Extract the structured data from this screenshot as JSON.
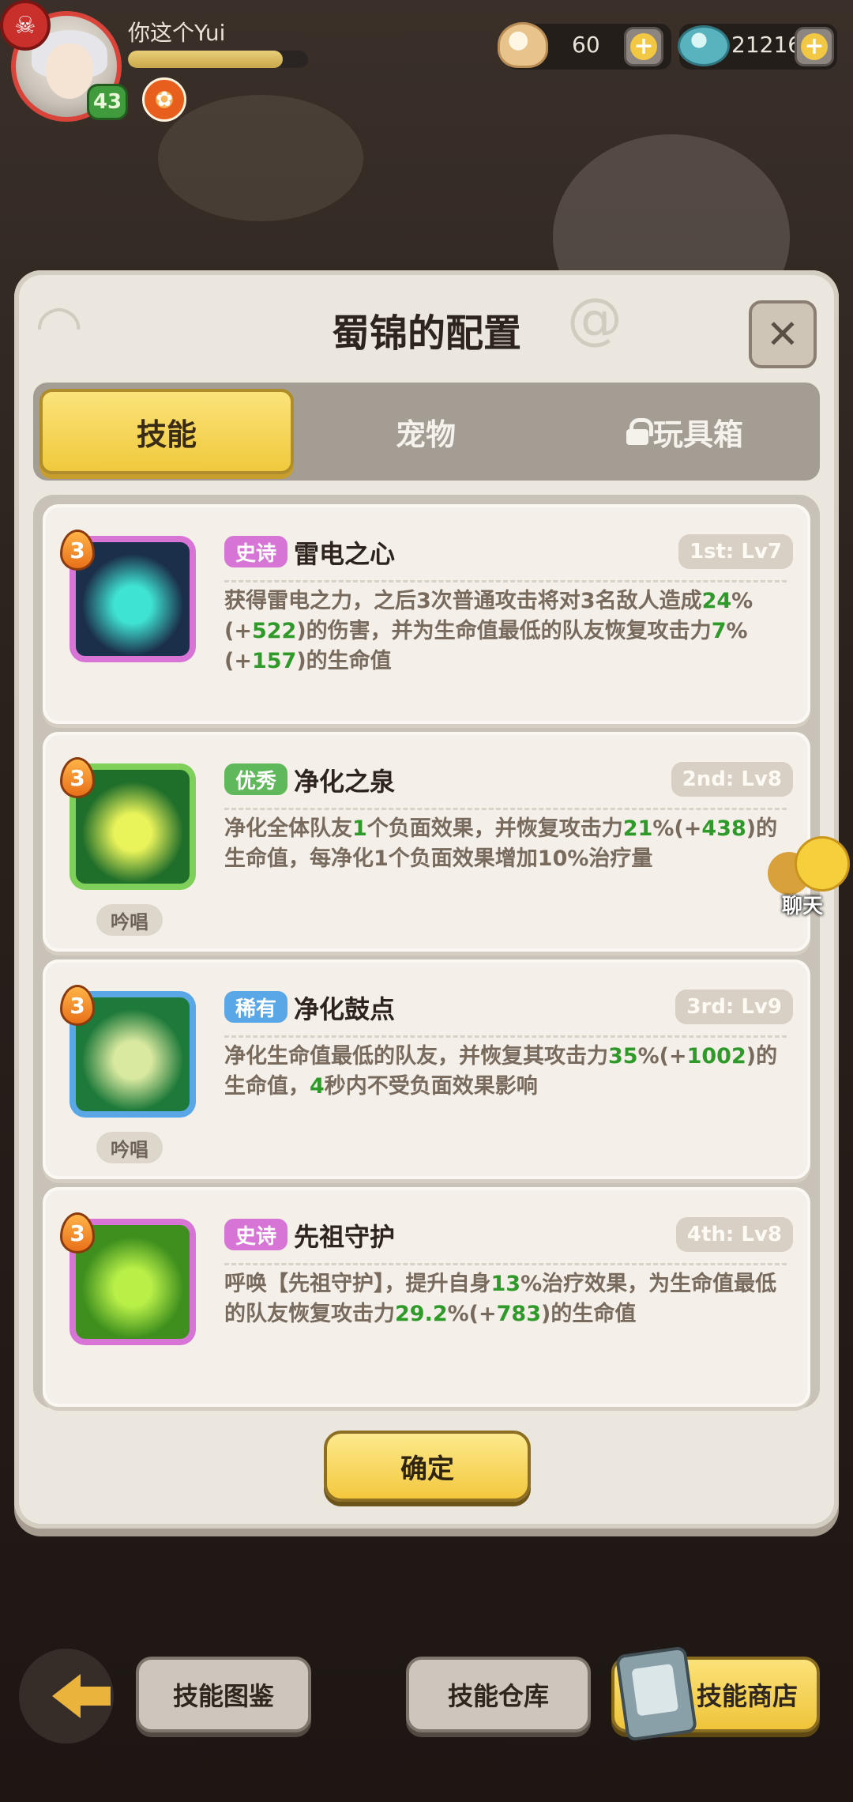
{
  "hud": {
    "player_name": "你这个Yui",
    "level": "43",
    "xp_fraction": 0.86,
    "shells": "60",
    "gems": "21216"
  },
  "dialog": {
    "title": "蜀锦的配置",
    "tabs": [
      {
        "label": "技能",
        "active": true,
        "locked": false
      },
      {
        "label": "宠物",
        "active": false,
        "locked": false
      },
      {
        "label": "玩具箱",
        "active": false,
        "locked": true
      }
    ],
    "skills": [
      {
        "rank": "3",
        "rarity": "史诗",
        "rarity_color": "#d775d6",
        "name": "雷电之心",
        "slot_level": "1st: Lv7",
        "chant": "",
        "desc_parts": [
          {
            "t": "获得雷电之力，之后3次普通攻击将对3名敌人造成"
          },
          {
            "t": "24",
            "g": true
          },
          {
            "t": "%(+"
          },
          {
            "t": "522",
            "g": true
          },
          {
            "t": ")的伤害，并为生命值最低的队友恢复攻击力"
          },
          {
            "t": "7",
            "g": true
          },
          {
            "t": "%(+"
          },
          {
            "t": "157",
            "g": true
          },
          {
            "t": ")的生命值"
          }
        ],
        "icon_colors": [
          "#d774d6",
          "#1b2f4a",
          "#3fe3d3"
        ]
      },
      {
        "rank": "3",
        "rarity": "优秀",
        "rarity_color": "#5fb95a",
        "name": "净化之泉",
        "slot_level": "2nd: Lv8",
        "chant": "吟唱",
        "desc_parts": [
          {
            "t": "净化全体队友"
          },
          {
            "t": "1",
            "g": true
          },
          {
            "t": "个负面效果，并恢复攻击力"
          },
          {
            "t": "21",
            "g": true
          },
          {
            "t": "%(+"
          },
          {
            "t": "438",
            "g": true
          },
          {
            "t": ")的生命值，每净化1个负面效果增加10%治疗量"
          }
        ],
        "icon_colors": [
          "#7fcf5b",
          "#1f6e2a",
          "#e9f35a"
        ]
      },
      {
        "rank": "3",
        "rarity": "稀有",
        "rarity_color": "#5aa7e8",
        "name": "净化鼓点",
        "slot_level": "3rd: Lv9",
        "chant": "吟唱",
        "desc_parts": [
          {
            "t": "净化生命值最低的队友，并恢复其攻击力"
          },
          {
            "t": "35",
            "g": true
          },
          {
            "t": "%(+"
          },
          {
            "t": "1002",
            "g": true
          },
          {
            "t": ")的生命值，"
          },
          {
            "t": "4",
            "g": true
          },
          {
            "t": "秒内不受负面效果影响"
          }
        ],
        "icon_colors": [
          "#5aa7e8",
          "#1e7a3a",
          "#d9e9a0"
        ]
      },
      {
        "rank": "3",
        "rarity": "史诗",
        "rarity_color": "#d775d6",
        "name": "先祖守护",
        "slot_level": "4th: Lv8",
        "chant": "",
        "desc_parts": [
          {
            "t": "呼唤【先祖守护】，提升自身"
          },
          {
            "t": "13",
            "g": true
          },
          {
            "t": "%治疗效果，为生命值最低的队友恢复攻击力"
          },
          {
            "t": "29.2",
            "g": true
          },
          {
            "t": "%(+"
          },
          {
            "t": "783",
            "g": true
          },
          {
            "t": ")的生命值"
          }
        ],
        "icon_colors": [
          "#d774d6",
          "#3e8f1e",
          "#b9f048"
        ]
      }
    ],
    "confirm_label": "确定"
  },
  "chat": {
    "label": "聊天"
  },
  "bottom": {
    "codex_label": "技能图鉴",
    "storage_label": "技能仓库",
    "shop_label": "技能商店"
  }
}
